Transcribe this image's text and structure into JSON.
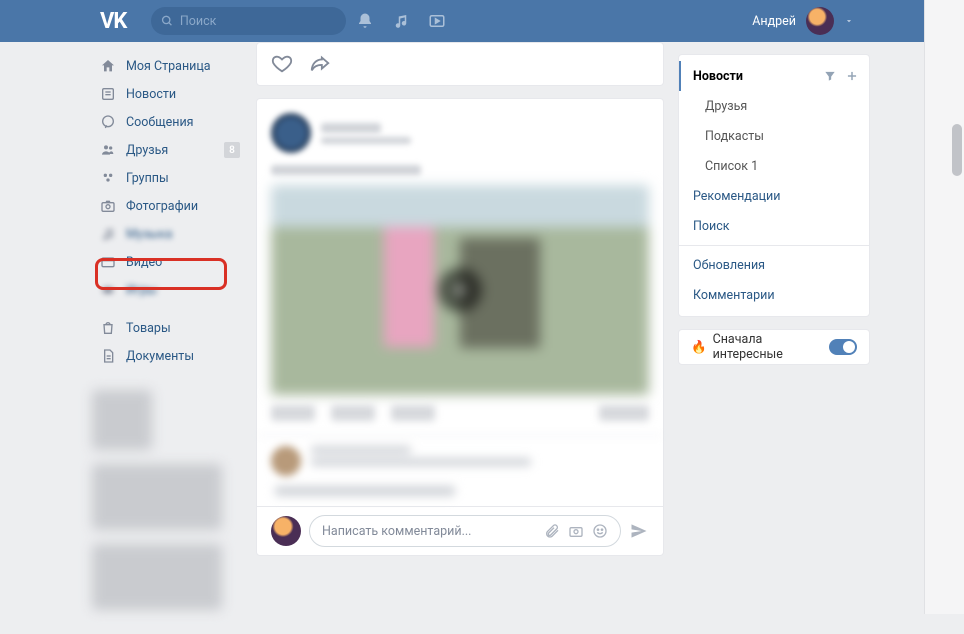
{
  "header": {
    "logo": "VK",
    "search_placeholder": "Поиск",
    "username": "Андрей"
  },
  "sidebar": {
    "items": [
      {
        "label": "Моя Страница",
        "icon": "home"
      },
      {
        "label": "Новости",
        "icon": "news"
      },
      {
        "label": "Сообщения",
        "icon": "chat"
      },
      {
        "label": "Друзья",
        "icon": "friends",
        "badge": "8"
      },
      {
        "label": "Группы",
        "icon": "groups"
      },
      {
        "label": "Фотографии",
        "icon": "camera"
      },
      {
        "label": "Музыка",
        "icon": "music",
        "blurred": true
      },
      {
        "label": "Видео",
        "icon": "video",
        "highlighted": true
      },
      {
        "label": "Игры",
        "icon": "games",
        "blurred": true
      },
      {
        "label": "Товары",
        "icon": "shop"
      },
      {
        "label": "Документы",
        "icon": "docs"
      }
    ]
  },
  "right": {
    "items": [
      {
        "label": "Новости",
        "active": true
      },
      {
        "label": "Друзья",
        "sub": true
      },
      {
        "label": "Подкасты",
        "sub": true
      },
      {
        "label": "Список 1",
        "sub": true
      },
      {
        "label": "Рекомендации"
      },
      {
        "label": "Поиск"
      },
      {
        "label": "Обновления"
      },
      {
        "label": "Комментарии"
      }
    ],
    "toggle_label": "Сначала интересные"
  },
  "comment": {
    "placeholder": "Написать комментарий..."
  }
}
